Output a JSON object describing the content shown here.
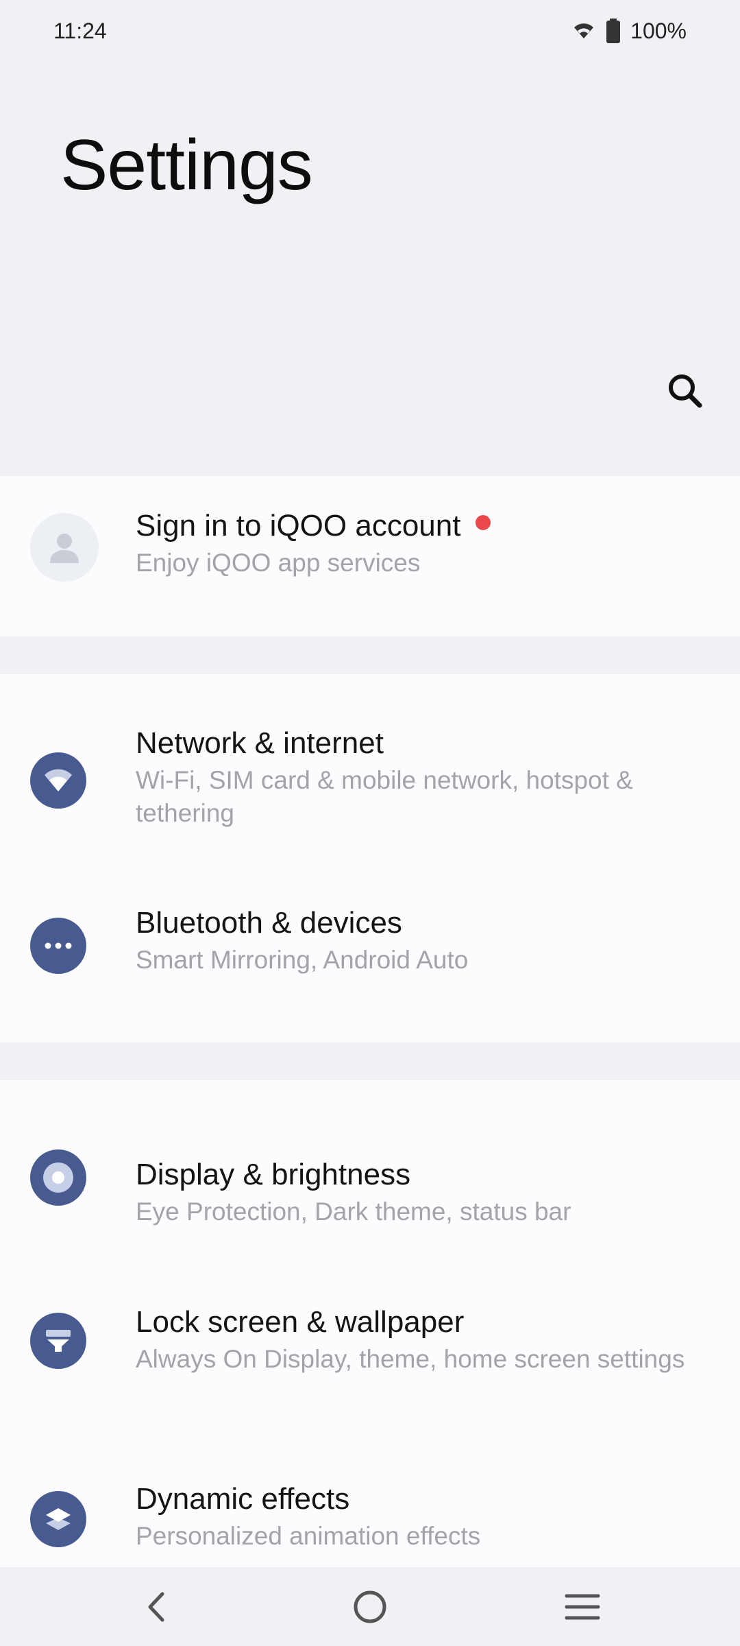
{
  "status_bar": {
    "time": "11:24",
    "battery": "100%",
    "icons": [
      "wifi-icon",
      "battery-icon"
    ]
  },
  "header": {
    "title": "Settings",
    "search_icon": "search-icon"
  },
  "account": {
    "title": "Sign in to iQOO account",
    "subtitle": "Enjoy iQOO app services",
    "has_notification": true,
    "notification_color": "#e9484d"
  },
  "group1": [
    {
      "title": "Network & internet",
      "subtitle": "Wi-Fi, SIM card & mobile network, hotspot & tethering",
      "icon": "wifi-icon"
    },
    {
      "title": "Bluetooth & devices",
      "subtitle": "Smart Mirroring, Android Auto",
      "icon": "more-dots-icon"
    }
  ],
  "group2": [
    {
      "title": "Display & brightness",
      "subtitle": "Eye Protection, Dark theme, status bar",
      "icon": "display-icon"
    },
    {
      "title": "Lock screen & wallpaper",
      "subtitle": "Always On Display, theme, home screen settings",
      "icon": "lock-screen-icon"
    },
    {
      "title": "Dynamic effects",
      "subtitle": "Personalized animation effects",
      "icon": "layers-icon"
    }
  ],
  "nav_bar": {
    "buttons": [
      "back-icon",
      "home-icon",
      "menu-icon"
    ]
  },
  "colors": {
    "accent_icon_bg": "#485b91",
    "background": "#f1f0f4",
    "card": "#fcfbfe",
    "subtitle": "#a3a3a8"
  }
}
